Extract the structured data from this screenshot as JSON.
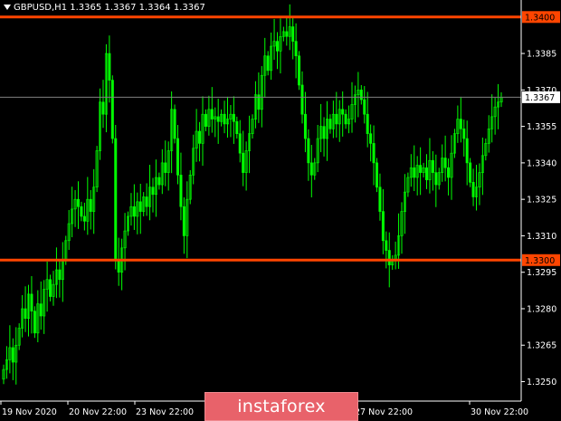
{
  "header": {
    "symbol": "GBPUSD,H1",
    "open": "1.3365",
    "high": "1.3367",
    "low": "1.3364",
    "close": "1.3367"
  },
  "watermark": "instaforex",
  "colors": {
    "background": "#000000",
    "candles": "#00ff00",
    "level_line": "#ff4500",
    "current_line": "#808080",
    "axis_text": "#ffffff"
  },
  "chart_data": {
    "type": "candlestick",
    "price_ticks": [
      "1.3385",
      "1.3370",
      "1.3355",
      "1.3340",
      "1.3325",
      "1.3310",
      "1.3295",
      "1.3280",
      "1.3265",
      "1.3250"
    ],
    "time_labels": [
      "19 Nov 2020",
      "20 Nov 22:00",
      "23 Nov 22:00",
      "27 Nov 22:00",
      "30 Nov 22:00"
    ],
    "ylim": [
      1.3242,
      1.3407
    ],
    "levels": [
      {
        "price": 1.34,
        "label": "1.3400"
      },
      {
        "price": 1.33,
        "label": "1.3300"
      }
    ],
    "current_price": {
      "price": 1.3367,
      "label": "1.3367"
    },
    "close_series": [
      1.3255,
      1.3259,
      1.3264,
      1.3258,
      1.3265,
      1.3272,
      1.328,
      1.3276,
      1.3286,
      1.3279,
      1.327,
      1.3282,
      1.3277,
      1.3288,
      1.3292,
      1.3285,
      1.329,
      1.3296,
      1.3292,
      1.33,
      1.3308,
      1.3315,
      1.3321,
      1.3325,
      1.3322,
      1.3318,
      1.3316,
      1.3325,
      1.332,
      1.333,
      1.3345,
      1.3365,
      1.336,
      1.3385,
      1.3374,
      1.335,
      1.33,
      1.3295,
      1.3305,
      1.3312,
      1.3318,
      1.3322,
      1.3318,
      1.3324,
      1.332,
      1.3326,
      1.3322,
      1.333,
      1.3327,
      1.3334,
      1.3331,
      1.334,
      1.3336,
      1.3345,
      1.3362,
      1.335,
      1.3335,
      1.3322,
      1.331,
      1.3325,
      1.3335,
      1.3346,
      1.3353,
      1.3348,
      1.336,
      1.3355,
      1.3362,
      1.3358,
      1.3359,
      1.3357,
      1.336,
      1.3356,
      1.3358,
      1.336,
      1.3357,
      1.3352,
      1.3344,
      1.3336,
      1.3345,
      1.3352,
      1.3358,
      1.3368,
      1.3362,
      1.3376,
      1.3384,
      1.3378,
      1.3388,
      1.339,
      1.3386,
      1.3392,
      1.3394,
      1.3392,
      1.3396,
      1.339,
      1.3384,
      1.3372,
      1.336,
      1.335,
      1.334,
      1.3335,
      1.334,
      1.335,
      1.3355,
      1.335,
      1.3358,
      1.3354,
      1.336,
      1.3356,
      1.3362,
      1.336,
      1.3356,
      1.3358,
      1.3364,
      1.3368,
      1.337,
      1.3366,
      1.336,
      1.3352,
      1.3348,
      1.334,
      1.333,
      1.332,
      1.3308,
      1.3304,
      1.3298,
      1.33,
      1.3302,
      1.331,
      1.332,
      1.3328,
      1.3334,
      1.3338,
      1.3334,
      1.3339,
      1.3336,
      1.3338,
      1.3333,
      1.3341,
      1.3336,
      1.3331,
      1.3336,
      1.3342,
      1.3338,
      1.3334,
      1.3344,
      1.3352,
      1.3358,
      1.3354,
      1.335,
      1.334,
      1.3332,
      1.3326,
      1.333,
      1.3336,
      1.3343,
      1.3348,
      1.3354,
      1.3359,
      1.3363,
      1.3365,
      1.3367
    ]
  }
}
